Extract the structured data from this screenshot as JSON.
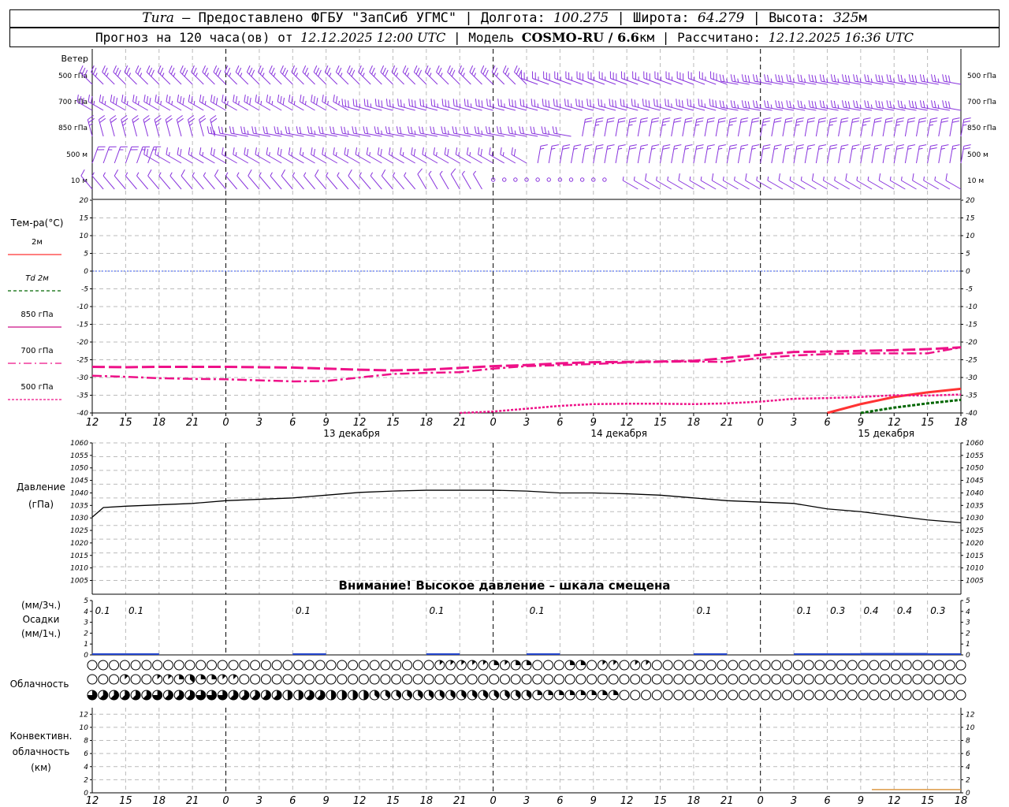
{
  "header": {
    "station": "Tura",
    "provider": "— Предоставлено ФГБУ \"ЗапСиб УГМС\"",
    "lon_label": "Долгота:",
    "lon": "100.275",
    "lat_label": "Широта:",
    "lat": "64.279",
    "alt_label": "Высота:",
    "alt": "325",
    "alt_unit": "м",
    "forecast_prefix": "Прогноз на 120 часа(ов) от",
    "forecast_start": "12.12.2025 12:00 UTC",
    "model_label": "Модель",
    "model": "COSMO-RU / 6.6",
    "model_unit": "км",
    "computed_label": "Рассчитано:",
    "computed": "12.12.2025 16:36 UTC"
  },
  "wind": {
    "title": "Ветер",
    "levels": [
      "500 гПа",
      "700 гПа",
      "850 гПа",
      "500 м",
      "10  м"
    ],
    "calm_10m_count": 11,
    "calm_500m_count": 1
  },
  "temp": {
    "title": "Тем-ра(°C)",
    "legend": [
      {
        "label": "2м",
        "color": "#ff3333",
        "dash": ""
      },
      {
        "label": "Td  2м",
        "color": "#006600",
        "dash": "4,3"
      },
      {
        "label": "850 гПа",
        "color": "#cc1188",
        "dash": ""
      },
      {
        "label": "700 гПа",
        "color": "#ee1188",
        "dash": "10,4,2,4"
      },
      {
        "label": "500 гПа",
        "color": "#ee1188",
        "dash": "3,2"
      }
    ],
    "ticks": [
      "20",
      "15",
      "10",
      "5",
      "0",
      "-5",
      "-10",
      "-15",
      "-20",
      "-25",
      "-30",
      "-35",
      "-40"
    ]
  },
  "time_axis": {
    "hours": [
      "12",
      "15",
      "18",
      "21",
      "0",
      "3",
      "6",
      "9",
      "12",
      "15",
      "18",
      "21",
      "0",
      "3",
      "6",
      "9",
      "12",
      "15",
      "18",
      "21",
      "0",
      "3",
      "6",
      "9",
      "12",
      "15",
      "18"
    ],
    "dates": [
      "13 декабря",
      "14 декабря",
      "15 декабря"
    ]
  },
  "pressure": {
    "title1": "Давление",
    "title2": "(гПа)",
    "ticks": [
      "1060",
      "1055",
      "1050",
      "1045",
      "1040",
      "1035",
      "1030",
      "1025",
      "1020",
      "1015",
      "1010",
      "1005"
    ],
    "warning": "Внимание! Высокое давление – шкала смещена"
  },
  "precip": {
    "title1": "(мм/3ч.)",
    "title2": "Осадки",
    "title3": "(мм/1ч.)",
    "ticks": [
      "5",
      "4",
      "3",
      "2",
      "1",
      "0"
    ],
    "labels": [
      {
        "h": 1.5,
        "text": "0.1"
      },
      {
        "h": 4.5,
        "text": "0.1"
      },
      {
        "h": 19.5,
        "text": "0.1"
      },
      {
        "h": 31.5,
        "text": "0.1"
      },
      {
        "h": 40.5,
        "text": "0.1"
      },
      {
        "h": 55.5,
        "text": "0.1"
      },
      {
        "h": 64.5,
        "text": "0.1"
      },
      {
        "h": 67.5,
        "text": "0.3"
      },
      {
        "h": 70.5,
        "text": "0.4"
      },
      {
        "h": 73.5,
        "text": "0.4"
      },
      {
        "h": 76.5,
        "text": "0.3"
      }
    ]
  },
  "cloud": {
    "title": "Облачность",
    "rows_octas": [
      [
        0,
        0,
        0,
        0,
        0,
        0,
        0,
        0,
        0,
        0,
        0,
        0,
        0,
        0,
        0,
        0,
        0,
        0,
        0,
        0,
        0,
        0,
        0,
        0,
        0,
        0,
        0,
        0,
        0,
        0,
        0,
        0,
        0,
        0,
        0,
        0,
        0,
        0,
        0,
        0,
        0,
        0,
        0,
        0,
        0,
        0,
        0,
        0,
        0,
        0,
        0,
        0,
        0,
        0,
        0,
        0,
        0,
        0,
        0,
        0,
        0,
        0,
        0,
        0,
        0,
        0,
        0,
        0,
        0,
        0,
        0,
        0,
        0,
        0,
        0,
        0,
        0,
        1,
        1,
        1,
        1,
        1,
        1,
        1,
        1,
        1,
        1,
        1,
        1,
        1,
        1,
        2,
        1,
        1,
        1,
        1,
        2,
        4,
        3,
        2,
        2,
        0,
        0,
        0,
        0,
        0,
        0,
        1,
        1,
        2,
        3,
        2,
        2,
        0,
        0,
        1,
        1,
        1,
        1,
        1,
        1,
        0,
        0,
        1,
        1,
        2,
        1,
        0,
        0,
        0,
        0,
        0,
        0,
        0,
        0,
        0,
        0,
        0,
        0,
        0,
        0,
        0,
        0,
        0,
        0,
        0,
        0,
        0,
        0,
        0,
        0,
        0,
        0,
        0,
        0,
        0,
        0,
        0,
        0,
        0,
        0,
        0,
        0,
        0,
        0,
        0,
        0,
        0,
        0,
        0,
        0,
        0,
        0,
        0,
        0,
        0,
        0,
        0,
        0,
        0,
        0,
        0,
        0,
        0,
        0,
        0,
        0,
        0,
        0,
        0,
        0,
        0,
        0,
        0,
        0,
        0,
        0,
        0,
        0,
        0,
        0
      ],
      [
        0,
        0,
        0,
        0,
        0,
        0,
        0,
        1,
        0,
        0,
        0,
        0,
        0,
        0,
        0,
        1,
        1,
        1,
        1,
        2,
        2,
        2,
        3,
        3,
        3,
        2,
        2,
        2,
        2,
        1,
        1,
        1,
        1,
        1,
        1,
        0,
        0,
        0,
        0,
        0,
        0,
        0,
        0,
        0,
        0,
        0,
        0,
        0,
        0,
        0,
        0,
        0,
        0,
        0,
        0,
        0,
        0,
        0,
        0,
        0,
        0,
        0,
        0,
        0,
        0,
        0,
        0,
        0,
        0,
        0,
        0,
        0,
        0,
        0,
        0,
        0,
        0,
        0,
        0,
        0,
        0,
        0,
        0,
        0,
        0,
        0,
        0,
        0,
        0,
        0,
        0,
        0,
        0,
        0,
        0,
        0,
        0,
        0,
        0,
        0,
        0,
        0,
        0,
        0,
        0,
        0,
        0,
        0,
        0,
        0,
        0,
        0,
        0,
        0,
        0,
        0,
        0,
        0,
        0,
        0,
        0,
        0,
        0,
        0,
        0,
        0,
        0,
        0,
        0,
        0,
        0,
        0,
        0,
        0,
        0,
        0,
        0,
        0,
        0,
        0,
        0,
        0,
        0,
        0,
        0,
        0,
        0,
        0,
        0,
        0,
        0,
        0,
        0,
        0,
        0,
        0,
        0,
        0,
        0,
        0,
        0,
        0,
        0,
        0,
        0,
        0,
        0,
        0,
        0,
        0,
        0,
        0,
        0,
        0,
        0,
        0,
        0,
        0,
        0,
        0,
        0,
        0,
        0,
        0,
        0,
        0,
        0,
        0,
        0,
        0,
        0,
        0,
        0,
        0,
        0,
        0,
        0,
        0,
        0,
        0,
        0,
        0,
        0
      ],
      [
        6,
        6,
        5,
        6,
        5,
        5,
        6,
        5,
        5,
        5,
        5,
        5,
        5,
        6,
        6,
        6,
        6,
        5,
        5,
        5,
        5,
        5,
        5,
        5,
        6,
        6,
        6,
        6,
        6,
        6,
        6,
        6,
        5,
        4,
        5,
        5,
        5,
        5,
        5,
        5,
        5,
        4,
        5,
        5,
        4,
        5,
        5,
        4,
        5,
        5,
        6,
        5,
        5,
        5,
        4,
        4,
        4,
        4,
        4,
        4,
        3,
        3,
        4,
        3,
        3,
        3,
        3,
        3,
        3,
        3,
        3,
        3,
        3,
        3,
        3,
        3,
        3,
        3,
        3,
        3,
        3,
        3,
        3,
        3,
        3,
        3,
        3,
        3,
        3,
        3,
        3,
        3,
        3,
        3,
        3,
        2,
        3,
        2,
        2,
        3,
        3,
        2,
        2,
        2,
        2,
        2,
        2,
        2,
        2,
        2,
        2,
        2,
        2,
        2,
        2,
        2,
        2,
        2,
        2,
        2,
        2,
        0,
        0,
        0,
        0,
        0,
        0,
        0,
        0,
        0,
        0,
        0,
        0,
        0,
        0,
        0,
        0,
        0,
        0,
        0,
        0,
        0,
        0,
        0,
        0,
        0,
        0,
        0,
        0,
        0,
        0,
        0,
        0,
        0,
        0,
        0,
        0,
        0,
        0,
        0,
        0,
        0,
        0,
        0,
        0,
        0,
        0,
        0,
        0,
        0,
        0,
        0,
        0,
        0,
        0,
        0,
        0,
        0,
        0,
        0,
        0,
        0,
        0,
        0,
        0,
        0,
        0,
        0,
        0,
        0,
        0,
        0,
        0,
        0,
        0,
        0,
        0,
        0,
        0,
        0,
        0
      ]
    ]
  },
  "conv": {
    "title1": "Конвективн.",
    "title2": "облачность",
    "title3": "(км)",
    "ticks": [
      "12",
      "10",
      "8",
      "6",
      "4",
      "2",
      "0"
    ]
  },
  "chart_data": [
    {
      "type": "line",
      "title": "Тем-ра(°C)",
      "x_unit": "hours from 12.12.2025 12:00 UTC",
      "ylim": [
        -40,
        20
      ],
      "series": [
        {
          "name": "2м",
          "x": [
            66,
            69,
            72,
            75,
            78
          ],
          "values": [
            -40,
            -37.5,
            -35.5,
            -34.2,
            -33.2
          ]
        },
        {
          "name": "Td  2м",
          "x": [
            69,
            72,
            75,
            78
          ],
          "values": [
            -40,
            -38.5,
            -37.3,
            -36.3
          ]
        },
        {
          "name": "850 гПа",
          "x": [
            0,
            3,
            6,
            9,
            12,
            15,
            18,
            21,
            24,
            27,
            30,
            33,
            36,
            39,
            42,
            45,
            48,
            51,
            54,
            57,
            60,
            63,
            66,
            69,
            72,
            75,
            78
          ],
          "values": [
            -27,
            -27.1,
            -27,
            -27,
            -27,
            -27.1,
            -27.2,
            -27.5,
            -27.8,
            -28,
            -27.8,
            -27.3,
            -26.8,
            -26.5,
            -26,
            -25.7,
            -25.6,
            -25.5,
            -25.3,
            -24.5,
            -23.6,
            -22.8,
            -22.7,
            -22.5,
            -22.3,
            -22,
            -21.5
          ]
        },
        {
          "name": "700 гПа",
          "x": [
            0,
            3,
            6,
            9,
            12,
            15,
            18,
            21,
            24,
            27,
            30,
            33,
            36,
            39,
            42,
            45,
            48,
            51,
            54,
            57,
            60,
            63,
            66,
            69,
            72,
            75,
            78
          ],
          "values": [
            -29.5,
            -29.8,
            -30.2,
            -30.4,
            -30.5,
            -30.8,
            -31.1,
            -31,
            -30,
            -29,
            -28.7,
            -28.5,
            -27.5,
            -26.8,
            -26.5,
            -26.2,
            -25.8,
            -25.6,
            -25.5,
            -25.6,
            -24.5,
            -23.8,
            -23.4,
            -23.2,
            -23.2,
            -23.2,
            -21.5
          ]
        },
        {
          "name": "500 гПа",
          "x": [
            33,
            36,
            39,
            42,
            45,
            48,
            51,
            54,
            57,
            60,
            63,
            66,
            69,
            72,
            75,
            78
          ],
          "values": [
            -40,
            -39.6,
            -38.8,
            -38,
            -37.5,
            -37.4,
            -37.4,
            -37.5,
            -37.3,
            -36.8,
            -36,
            -35.8,
            -35.5,
            -35,
            -35.1,
            -34.8
          ]
        }
      ]
    },
    {
      "type": "line",
      "title": "Давление (гПа)",
      "x_unit": "hours from 12.12.2025 12:00 UTC",
      "ylim": [
        1005,
        1060
      ],
      "series": [
        {
          "name": "",
          "x": [
            0,
            1,
            3,
            6,
            9,
            12,
            15,
            18,
            21,
            24,
            27,
            30,
            33,
            36,
            39,
            42,
            45,
            48,
            51,
            54,
            57,
            60,
            63,
            66,
            69,
            72,
            75,
            78
          ],
          "values": [
            1033,
            1036.5,
            1037,
            1037.5,
            1038,
            1039,
            1039.5,
            1040,
            1041,
            1042,
            1042.5,
            1042.8,
            1042.8,
            1042.8,
            1042.5,
            1041.8,
            1041.8,
            1041.5,
            1041,
            1040,
            1039,
            1038.5,
            1038,
            1036,
            1035,
            1033.5,
            1032,
            1031
          ]
        }
      ]
    },
    {
      "type": "bar",
      "title": "Осадки (мм/3ч.)",
      "x_unit": "hours from 12.12.2025 12:00 UTC",
      "ylim": [
        0,
        5
      ],
      "x": [
        1.5,
        4.5,
        19.5,
        31.5,
        40.5,
        55.5,
        64.5,
        67.5,
        70.5,
        73.5,
        76.5
      ],
      "values": [
        0.1,
        0.1,
        0.1,
        0.1,
        0.1,
        0.1,
        0.1,
        0.3,
        0.4,
        0.4,
        0.3
      ]
    },
    {
      "type": "line",
      "title": "Конвективн. облачность (км)",
      "x_unit": "hours from 12.12.2025 12:00 UTC",
      "ylim": [
        0,
        13
      ],
      "series": [
        {
          "name": "",
          "x": [
            70,
            78
          ],
          "values": [
            0.5,
            0.5
          ]
        }
      ]
    }
  ]
}
